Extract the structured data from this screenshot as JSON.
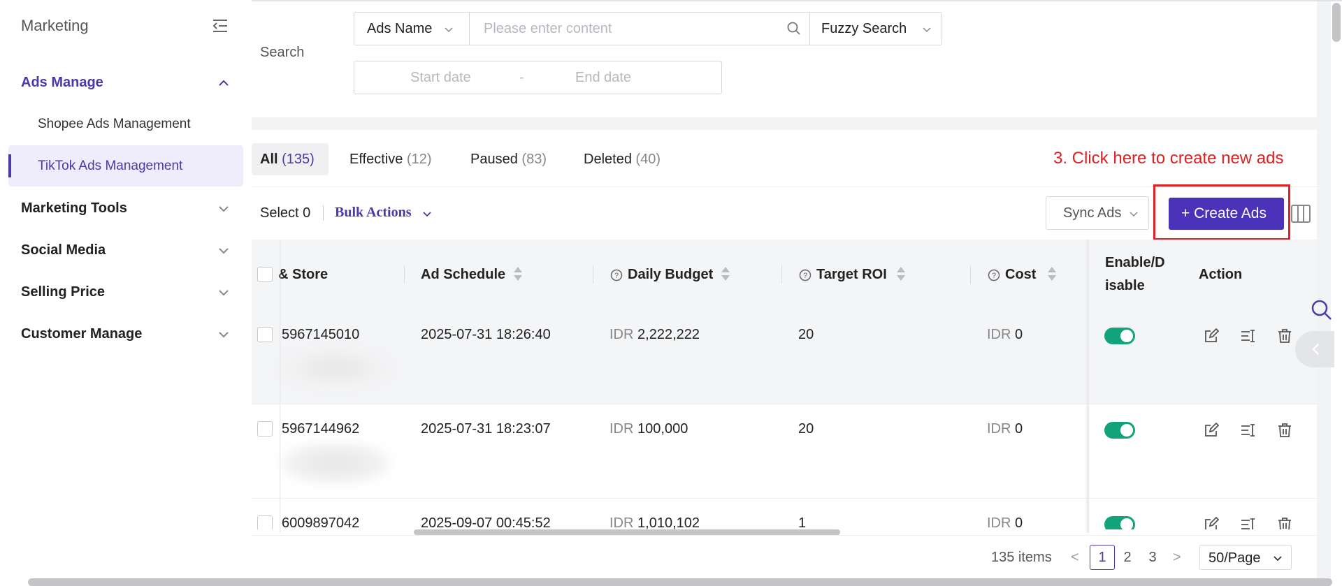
{
  "sidebar": {
    "title": "Marketing",
    "items": [
      {
        "label": "Ads Manage",
        "expanded": true
      },
      {
        "label": "Marketing Tools"
      },
      {
        "label": "Social Media"
      },
      {
        "label": "Selling Price"
      },
      {
        "label": "Customer Manage"
      }
    ],
    "subitems": [
      "Shopee Ads Management",
      "TikTok Ads Management"
    ]
  },
  "search": {
    "label": "Search",
    "field_select": "Ads Name",
    "placeholder": "Please enter content",
    "mode_select": "Fuzzy Search",
    "start_placeholder": "Start date",
    "date_separator": "-",
    "end_placeholder": "End date"
  },
  "tabs": [
    {
      "label": "All",
      "count": "(135)"
    },
    {
      "label": "Effective",
      "count": "(12)"
    },
    {
      "label": "Paused",
      "count": "(83)"
    },
    {
      "label": "Deleted",
      "count": "(40)"
    }
  ],
  "annotation": "3. Click here to create new ads",
  "toolbar": {
    "select_text": "Select 0",
    "bulk_actions": "Bulk Actions",
    "sync_ads": "Sync Ads",
    "create_ads": "+ Create Ads"
  },
  "table": {
    "headers": {
      "store": "& Store",
      "schedule": "Ad Schedule",
      "budget": "Daily Budget",
      "roi": "Target ROI",
      "cost": "Cost",
      "enable_1": "Enable/D",
      "enable_2": "isable",
      "action": "Action"
    },
    "rows": [
      {
        "id": "5967145010",
        "schedule": "2025-07-31 18:26:40",
        "budget_unit": "IDR",
        "budget": "2,222,222",
        "roi": "20",
        "cost_unit": "IDR",
        "cost": "0",
        "enabled": true
      },
      {
        "id": "5967144962",
        "schedule": "2025-07-31 18:23:07",
        "budget_unit": "IDR",
        "budget": "100,000",
        "roi": "20",
        "cost_unit": "IDR",
        "cost": "0",
        "enabled": true
      },
      {
        "id": "6009897042",
        "schedule": "2025-09-07 00:45:52",
        "budget_unit": "IDR",
        "budget": "1,010,102",
        "roi": "1",
        "cost_unit": "IDR",
        "cost": "0",
        "enabled": true
      }
    ]
  },
  "pagination": {
    "total": "135 items",
    "prev": "<",
    "pages": [
      "1",
      "2",
      "3"
    ],
    "next": ">",
    "page_size": "50/Page"
  },
  "colors": {
    "accent": "#4a33b8",
    "annotation": "#e02020",
    "toggle_on": "#12a37a"
  }
}
